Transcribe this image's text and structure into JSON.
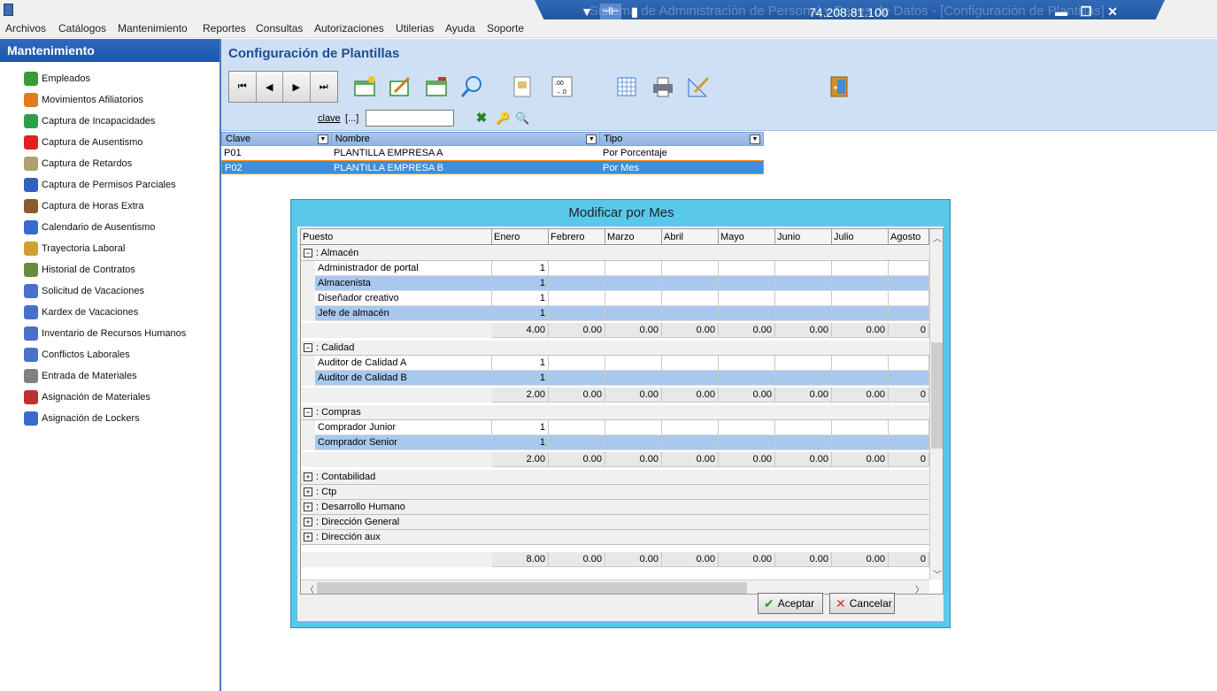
{
  "window": {
    "remote_title": "Sistema de Administración de Personal y Bases de Datos - [Configuración de Plantillas]",
    "remote_ip": "74.208.81.100",
    "dropdown_glyph": "▼",
    "pin_glyph": "⊣⊢",
    "signal_glyph": "▮",
    "minimize_glyph": "▬",
    "restore_glyph": "❐",
    "close_glyph": "✕"
  },
  "menu": [
    "Archivos",
    "Catálogos",
    "Mantenimiento",
    "Reportes",
    "Consultas",
    "Autorizaciones",
    "Utilerias",
    "Ayuda",
    "Soporte"
  ],
  "sidebar": {
    "title": "Mantenimiento",
    "items": [
      {
        "label": "Empleados",
        "icon": "person-icon",
        "color": "#3a9a3a"
      },
      {
        "label": "Movimientos Afiliatorios",
        "icon": "people-icon",
        "color": "#e07b20"
      },
      {
        "label": "Captura de Incapacidades",
        "icon": "medical-icon",
        "color": "#2fa04a"
      },
      {
        "label": "Captura de Ausentismo",
        "icon": "absence-icon",
        "color": "#e02020"
      },
      {
        "label": "Captura de Retardos",
        "icon": "clock-icon",
        "color": "#b0a070"
      },
      {
        "label": "Captura de Permisos Parciales",
        "icon": "permit-icon",
        "color": "#3060c0"
      },
      {
        "label": "Captura de Horas Extra",
        "icon": "overtime-icon",
        "color": "#8a5a30"
      },
      {
        "label": "Calendario de Ausentismo",
        "icon": "calendar-icon",
        "color": "#3a6ad0"
      },
      {
        "label": "Trayectoria Laboral",
        "icon": "career-icon",
        "color": "#d0a030"
      },
      {
        "label": "Historial de Contratos",
        "icon": "contract-icon",
        "color": "#6a8a40"
      },
      {
        "label": "Solicitud de Vacaciones",
        "icon": "vacation-request-icon",
        "color": "#4a70c8"
      },
      {
        "label": "Kardex de Vacaciones",
        "icon": "kardex-icon",
        "color": "#4a70c8"
      },
      {
        "label": "Inventario de Recursos Humanos",
        "icon": "inventory-icon",
        "color": "#4a70c8"
      },
      {
        "label": "Conflictos Laborales",
        "icon": "conflict-icon",
        "color": "#4a70c8"
      },
      {
        "label": "Entrada de Materiales",
        "icon": "materials-entry-icon",
        "color": "#808080"
      },
      {
        "label": "Asignación de Materiales",
        "icon": "materials-assign-icon",
        "color": "#c03030"
      },
      {
        "label": "Asignación de Lockers",
        "icon": "locker-icon",
        "color": "#3a6ad0"
      }
    ]
  },
  "main": {
    "title": "Configuración de Plantillas",
    "nav": [
      "⏮",
      "◀",
      "▶",
      "⏭"
    ],
    "clave_label": "clave",
    "clave_browse": "[...]",
    "clave_value": "",
    "grid": {
      "headers": [
        "Clave",
        "Nombre",
        "Tipo"
      ],
      "rows": [
        {
          "clave": "P01",
          "nombre": "PLANTILLA EMPRESA A",
          "tipo": "Por Porcentaje"
        },
        {
          "clave": "P02",
          "nombre": "PLANTILLA EMPRESA B",
          "tipo": "Por Mes"
        }
      ]
    }
  },
  "dialog": {
    "title": "Modificar por Mes",
    "columns": [
      "Puesto",
      "Enero",
      "Febrero",
      "Marzo",
      "Abril",
      "Mayo",
      "Junio",
      "Julio",
      "Agosto"
    ],
    "groups": [
      {
        "expander": "−",
        "label": ": Almacén",
        "rows": [
          {
            "puesto": "Administrador de portal",
            "enero": "1"
          },
          {
            "puesto": "Almacenista",
            "enero": "1"
          },
          {
            "puesto": "Diseñador creativo",
            "enero": "1"
          },
          {
            "puesto": "Jefe de almacén",
            "enero": "1"
          }
        ],
        "totals": [
          "4.00",
          "0.00",
          "0.00",
          "0.00",
          "0.00",
          "0.00",
          "0.00",
          "0"
        ]
      },
      {
        "expander": "−",
        "label": ": Calidad",
        "rows": [
          {
            "puesto": "Auditor de Calidad A",
            "enero": "1"
          },
          {
            "puesto": "Auditor de Calidad B",
            "enero": "1"
          }
        ],
        "totals": [
          "2.00",
          "0.00",
          "0.00",
          "0.00",
          "0.00",
          "0.00",
          "0.00",
          "0"
        ]
      },
      {
        "expander": "−",
        "label": ": Compras",
        "rows": [
          {
            "puesto": "Comprador Junior",
            "enero": "1"
          },
          {
            "puesto": "Comprador Senior",
            "enero": "1"
          }
        ],
        "totals": [
          "2.00",
          "0.00",
          "0.00",
          "0.00",
          "0.00",
          "0.00",
          "0.00",
          "0"
        ]
      }
    ],
    "collapsed_groups": [
      {
        "expander": "+",
        "label": ": Contabilidad"
      },
      {
        "expander": "+",
        "label": ": Ctp"
      },
      {
        "expander": "+",
        "label": ": Desarrollo Humano"
      },
      {
        "expander": "+",
        "label": ": Dirección General"
      },
      {
        "expander": "+",
        "label": ": Dirección aux"
      }
    ],
    "grand_totals": [
      "8.00",
      "0.00",
      "0.00",
      "0.00",
      "0.00",
      "0.00",
      "0.00",
      "0"
    ],
    "accept_label": "Aceptar",
    "cancel_label": "Cancelar",
    "accept_glyph": "✔",
    "cancel_glyph": "✕"
  },
  "toolbar": {
    "accept_glyph": "✖",
    "key_glyph": "🔑",
    "search_glyph": "🔍"
  }
}
